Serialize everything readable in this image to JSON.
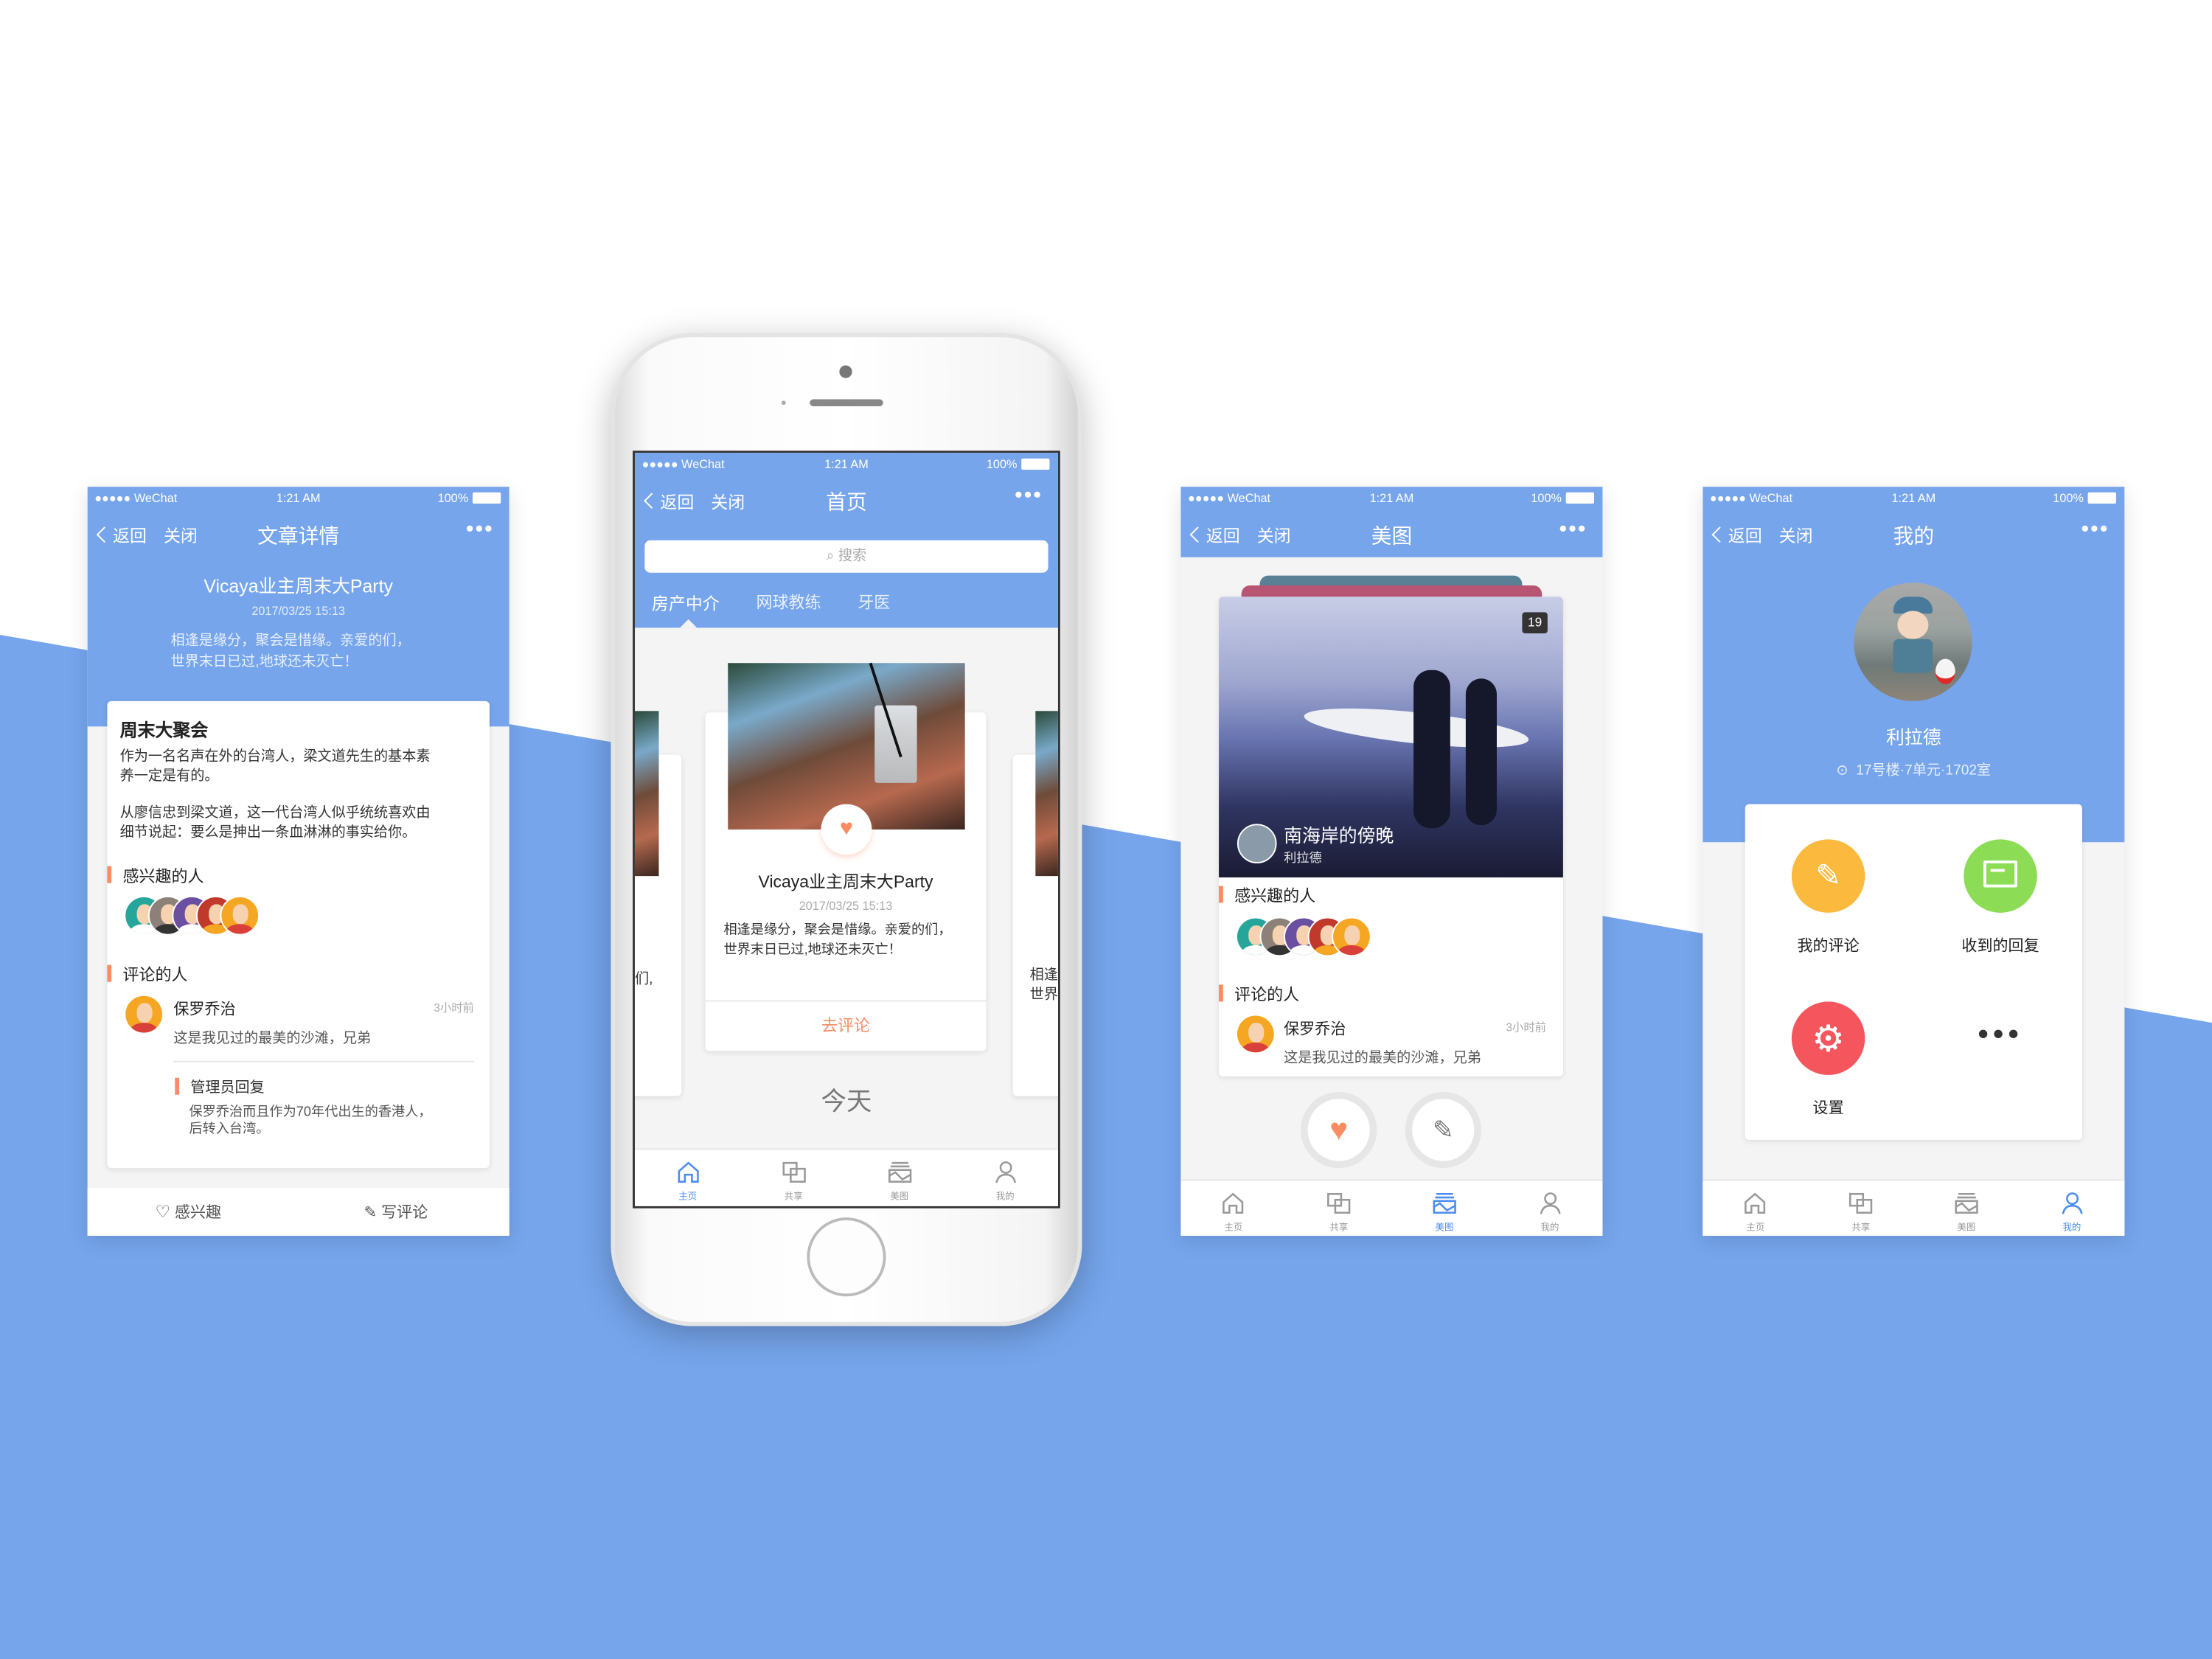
{
  "colors": {
    "primary": "#76a5ec",
    "accent": "#f98c63",
    "tab_active": "#4a8cf0",
    "icon_yellow": "#fbb93d",
    "icon_green": "#8ddc55",
    "icon_red": "#f5565d"
  },
  "status_bar": {
    "carrier": "●●●●● WeChat",
    "time": "1:21 AM",
    "battery": "100%"
  },
  "nav": {
    "back": "返回",
    "close": "关闭",
    "more": "•••"
  },
  "tabs": [
    {
      "label": "主页",
      "icon": "home-icon"
    },
    {
      "label": "共享",
      "icon": "share-icon"
    },
    {
      "label": "美图",
      "icon": "image-icon"
    },
    {
      "label": "我的",
      "icon": "user-icon"
    }
  ],
  "article_screen": {
    "title": "文章详情",
    "headline": "Vicaya业主周末大Party",
    "date": "2017/03/25 15:13",
    "summary_1": "相逢是缘分，聚会是惜缘。亲爱的们，",
    "summary_2": "世界末日已过,地球还未灭亡！",
    "card_title": "周末大聚会",
    "para1_1": "作为一名名声在外的台湾人，梁文道先生的基本素",
    "para1_2": "养一定是有的。",
    "para2_1": "从廖信忠到梁文道，这一代台湾人似乎统统喜欢由",
    "para2_2": "细节说起：要么是抻出一条血淋淋的事实给你。",
    "interested_label": "感兴趣的人",
    "commenters_label": "评论的人",
    "comment": {
      "name": "保罗乔治",
      "time": "3小时前",
      "text": "这是我见过的最美的沙滩，兄弟"
    },
    "reply": {
      "label": "管理员回复",
      "text_1": "保罗乔治而且作为70年代出生的香港人，",
      "text_2": "后转入台湾。"
    },
    "bottom": {
      "like": "感兴趣",
      "write": "写评论"
    }
  },
  "home_screen": {
    "title": "首页",
    "search_placeholder": "搜索",
    "categories": [
      "房产中介",
      "网球教练",
      "牙医"
    ],
    "active_category": 0,
    "card": {
      "title": "Vicaya业主周末大Party",
      "date": "2017/03/25 15:13",
      "desc_1": "相逢是缘分，聚会是惜缘。亲爱的们，",
      "desc_2": "世界末日已过,地球还未灭亡！",
      "action": "去评论"
    },
    "left_peek": "们,",
    "right_peek_1": "相逢",
    "right_peek_2": "世界",
    "section": "今天",
    "active_tab": 0
  },
  "gallery_screen": {
    "title": "美图",
    "count_badge": "19",
    "photo_title": "南海岸的傍晚",
    "photo_author": "利拉德",
    "interested_label": "感兴趣的人",
    "commenters_label": "评论的人",
    "comment": {
      "name": "保罗乔治",
      "time": "3小时前",
      "text": "这是我见过的最美的沙滩，兄弟"
    },
    "active_tab": 2
  },
  "profile_screen": {
    "title": "我的",
    "name": "利拉德",
    "address": "17号楼·7单元·1702室",
    "menu": [
      {
        "label": "我的评论",
        "icon": "edit-icon"
      },
      {
        "label": "收到的回复",
        "icon": "message-icon"
      },
      {
        "label": "设置",
        "icon": "gear-icon"
      },
      {
        "label": "",
        "icon": "more-icon"
      }
    ],
    "active_tab": 3
  }
}
